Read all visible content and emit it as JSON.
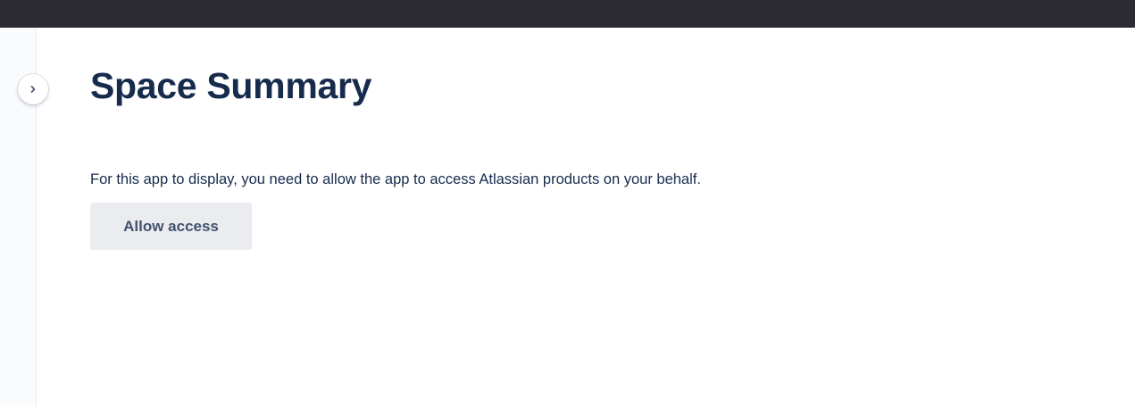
{
  "header": {
    "bar_color": "#2c2a33"
  },
  "sidebar": {
    "expand_icon": "chevron-right-icon"
  },
  "main": {
    "title": "Space Summary",
    "message": "For this app to display, you need to allow the app to access Atlassian products on your behalf.",
    "allow_button_label": "Allow access"
  },
  "colors": {
    "text_primary": "#172b4d",
    "button_bg": "#ebecf0",
    "button_text": "#42526e"
  }
}
